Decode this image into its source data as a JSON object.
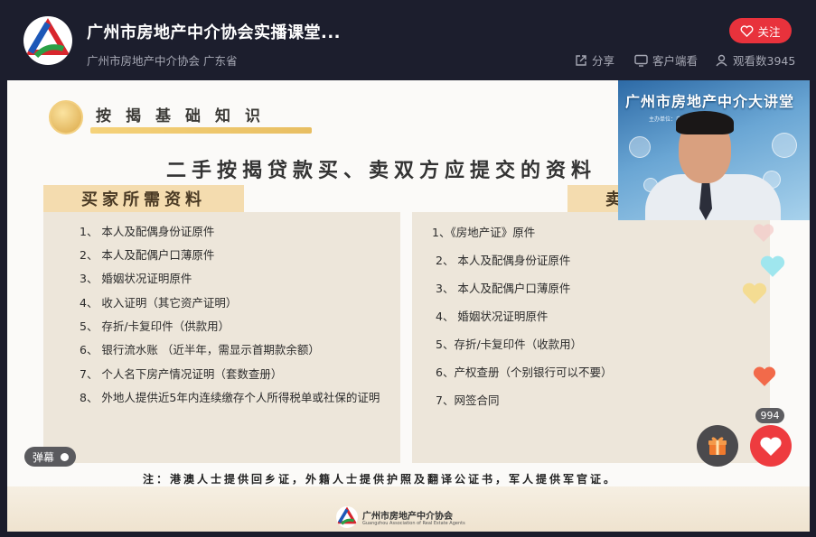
{
  "header": {
    "title": "广州市房地产中介协会实播课堂...",
    "subtitle": "广州市房地产中介协会 广东省",
    "follow_label": "关注",
    "share_label": "分享",
    "client_watch_label": "客户端看",
    "view_count_label": "观看数3945"
  },
  "slide": {
    "section_title": "按揭基础知识",
    "main_title": "二手按揭贷款买、卖双方应提交的资料",
    "buyer_heading": "买家所需资料",
    "seller_heading_partial": "卖",
    "buyer_items": [
      "1、 本人及配偶身份证原件",
      "2、 本人及配偶户口薄原件",
      "3、 婚姻状况证明原件",
      "4、 收入证明（其它资产证明）",
      "5、 存折/卡复印件（供款用）",
      "6、 银行流水账 （近半年，需显示首期款余额）",
      "7、 个人名下房产情况证明（套数查册）",
      "8、 外地人提供近5年内连续缴存个人所得税单或社保的证明"
    ],
    "seller_items": [
      "1、《房地产证》原件",
      "2、 本人及配偶身份证原件",
      "3、 本人及配偶户口薄原件",
      "4、 婚姻状况证明原件",
      "5、存折/卡复印件（收款用）",
      "6、产权查册（个别银行可以不要）",
      "7、网签合同"
    ],
    "note": "注：港澳人士提供回乡证，外籍人士提供护照及翻译公证书，军人提供军官证。",
    "footer_org": "广州市房地产中介协会",
    "footer_org_en": "Guangzhou Association of Real Estate Agents"
  },
  "video": {
    "title": "广州市房地产中介大讲堂",
    "sub": "主办单位：广州市房地产中介协会"
  },
  "controls": {
    "danmu_label": "弹幕",
    "like_count": "994"
  },
  "colors": {
    "accent": "#e8323c",
    "header_bg": "#1c1e2d",
    "panel_bg": "#ede6da",
    "heading_bg": "#f4dcaf"
  }
}
